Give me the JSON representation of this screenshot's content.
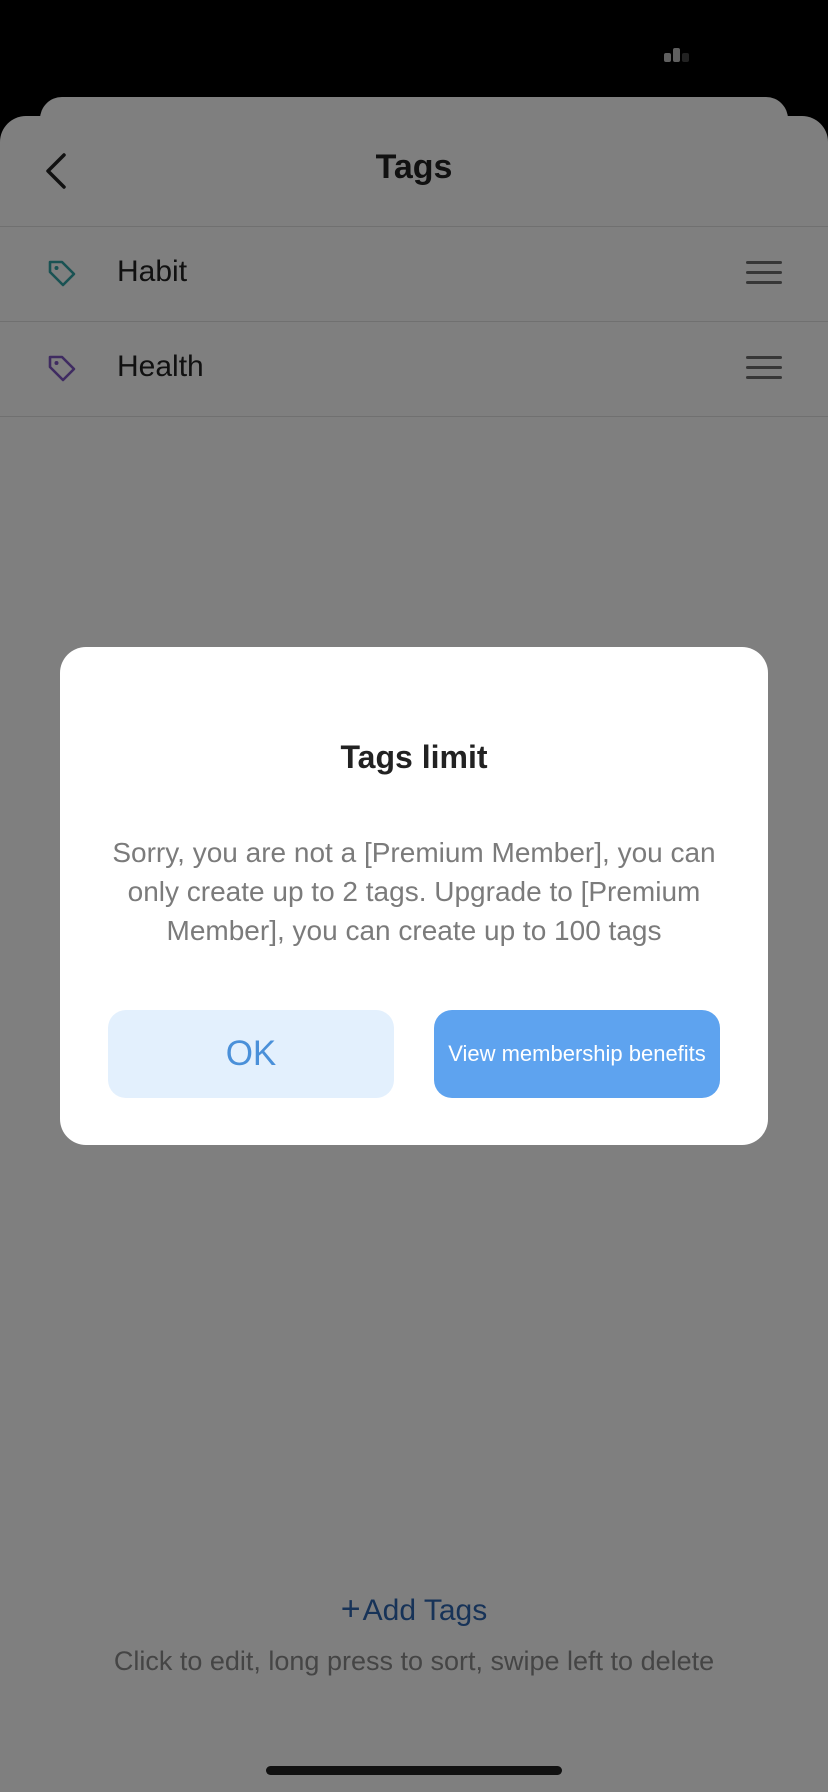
{
  "header": {
    "title": "Tags"
  },
  "tags": [
    {
      "label": "Habit",
      "icon": "tag-icon",
      "color": "#33a4a6"
    },
    {
      "label": "Health",
      "icon": "tag-icon",
      "color": "#7e57c2"
    }
  ],
  "footer": {
    "add_label": "Add Tags",
    "add_icon": "+",
    "hint": "Click to edit, long press to sort,  swipe left to delete"
  },
  "dialog": {
    "title": "Tags limit",
    "message": "Sorry, you are not a [Premium Member], you can only create up to 2 tags. Upgrade to [Premium Member], you can create up to 100 tags",
    "ok_label": "OK",
    "benefits_label": "View membership benefits"
  },
  "colors": {
    "accent": "#5ea3ef",
    "ok_bg": "#e3f0fd",
    "link": "#2f66b0"
  }
}
